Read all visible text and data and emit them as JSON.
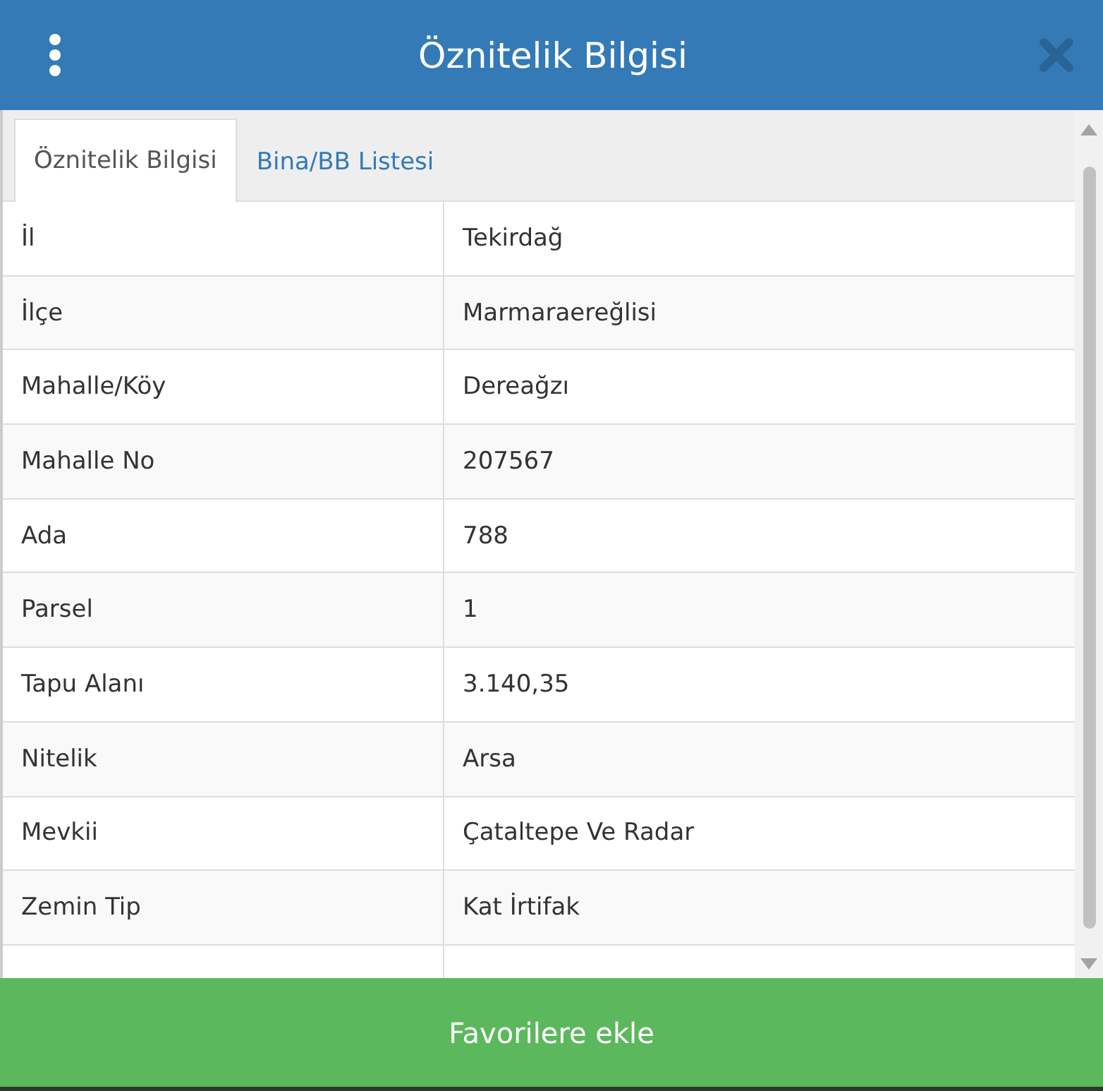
{
  "window": {
    "title": "Öznitelik Bilgisi"
  },
  "tabs": [
    {
      "label": "Öznitelik Bilgisi",
      "selected": true
    },
    {
      "label": "Bina/BB Listesi",
      "selected": false
    }
  ],
  "table": {
    "rows": [
      {
        "label": "İl",
        "value": "Tekirdağ"
      },
      {
        "label": "İlçe",
        "value": "Marmaraereğlisi"
      },
      {
        "label": "Mahalle/Köy",
        "value": "Dereağzı"
      },
      {
        "label": "Mahalle No",
        "value": "207567"
      },
      {
        "label": "Ada",
        "value": "788"
      },
      {
        "label": "Parsel",
        "value": "1"
      },
      {
        "label": "Tapu Alanı",
        "value": "3.140,35"
      },
      {
        "label": "Nitelik",
        "value": "Arsa"
      },
      {
        "label": "Mevkii",
        "value": "Çataltepe Ve Radar"
      },
      {
        "label": "Zemin Tip",
        "value": "Kat İrtifak"
      }
    ]
  },
  "button": {
    "label": "Favorilere ekle"
  }
}
